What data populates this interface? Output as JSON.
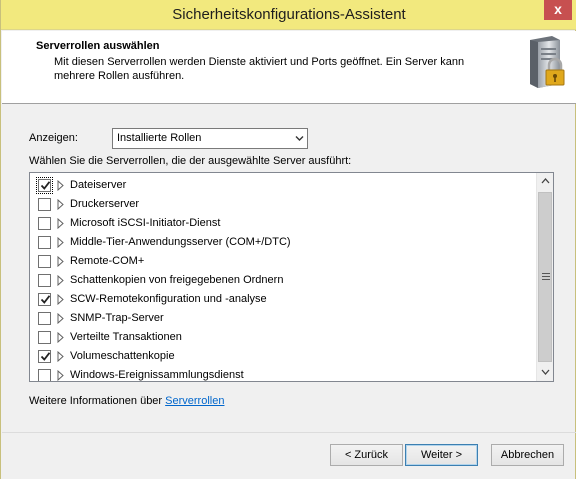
{
  "window": {
    "title": "Sicherheitskonfigurations-Assistent",
    "close_glyph": "x"
  },
  "header": {
    "title": "Serverrollen auswählen",
    "description": "Mit diesen Serverrollen werden Dienste aktiviert und Ports geöffnet. Ein Server kann mehrere Rollen ausführen."
  },
  "filter": {
    "label": "Anzeigen:",
    "selected": "Installierte Rollen"
  },
  "list": {
    "label": "Wählen Sie die Serverrollen, die der ausgewählte Server ausführt:",
    "items": [
      {
        "label": "Dateiserver",
        "checked": true
      },
      {
        "label": "Druckerserver",
        "checked": false
      },
      {
        "label": "Microsoft iSCSI-Initiator-Dienst",
        "checked": false
      },
      {
        "label": "Middle-Tier-Anwendungsserver (COM+/DTC)",
        "checked": false
      },
      {
        "label": "Remote-COM+",
        "checked": false
      },
      {
        "label": "Schattenkopien von freigegebenen Ordnern",
        "checked": false
      },
      {
        "label": "SCW-Remotekonfiguration und -analyse",
        "checked": true
      },
      {
        "label": "SNMP-Trap-Server",
        "checked": false
      },
      {
        "label": "Verteilte Transaktionen",
        "checked": false
      },
      {
        "label": "Volumeschattenkopie",
        "checked": true
      },
      {
        "label": "Windows-Ereignissammlungsdienst",
        "checked": false
      }
    ]
  },
  "more_info": {
    "prefix": "Weitere Informationen über",
    "link": "Serverrollen"
  },
  "buttons": {
    "back": "< Zurück",
    "next": "Weiter >",
    "cancel": "Abbrechen"
  },
  "icons": {
    "close": "close-icon",
    "header": "server-lock-icon",
    "dropdown": "chevron-down-icon",
    "expand": "expand-triangle-icon",
    "check": "checkmark-icon"
  },
  "colors": {
    "titlebar": "#f2e97e",
    "close": "#c75050",
    "link": "#0066cc"
  }
}
